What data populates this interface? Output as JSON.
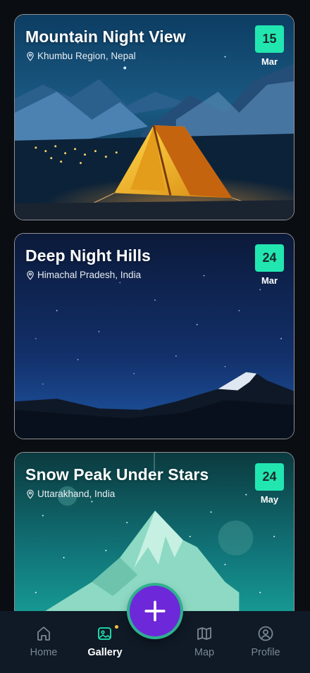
{
  "cards": [
    {
      "title": "Mountain Night View",
      "location": "Khumbu Region, Nepal",
      "day": "15",
      "month": "Mar"
    },
    {
      "title": "Deep Night Hills",
      "location": "Himachal Pradesh, India",
      "day": "24",
      "month": "Mar"
    },
    {
      "title": "Snow Peak Under Stars",
      "location": "Uttarakhand, India",
      "day": "24",
      "month": "May"
    }
  ],
  "nav": {
    "items": [
      {
        "label": "Home",
        "icon": "home-icon"
      },
      {
        "label": "Gallery",
        "icon": "gallery-icon"
      },
      {
        "label": "Map",
        "icon": "map-icon"
      },
      {
        "label": "Profile",
        "icon": "profile-icon"
      }
    ],
    "active": "Gallery",
    "fab_icon": "plus-icon"
  },
  "colors": {
    "accent": "#22e6b0",
    "fab": "#6d28d9",
    "nav_bg": "#0f1a26",
    "background": "#0a0d12"
  }
}
